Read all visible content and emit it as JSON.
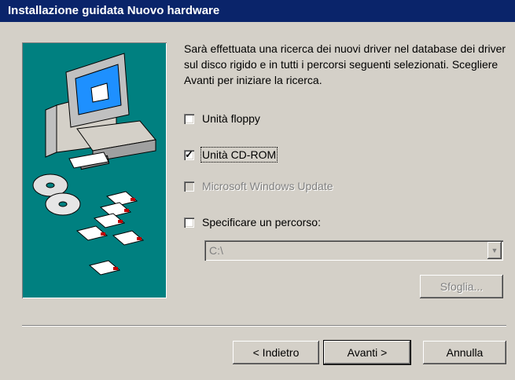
{
  "window": {
    "title": "Installazione guidata Nuovo hardware"
  },
  "intro_text": "Sarà effettuata una ricerca dei nuovi driver nel database dei driver sul disco rigido e in tutti i percorsi seguenti selezionati. Scegliere Avanti per iniziare la ricerca.",
  "options": {
    "floppy": {
      "label": "Unità floppy",
      "checked": false
    },
    "cdrom": {
      "label": "Unità CD-ROM",
      "checked": true
    },
    "windows_update": {
      "label": "Microsoft Windows Update",
      "checked": false,
      "enabled": false
    },
    "path": {
      "label": "Specificare un percorso:",
      "checked": false
    }
  },
  "path_field": {
    "value": "C:\\"
  },
  "buttons": {
    "browse": "Sfoglia...",
    "back": "< Indietro",
    "next": "Avanti >",
    "cancel": "Annulla"
  },
  "colors": {
    "titlebar": "#0a246a",
    "art_background": "#008080",
    "dialog_face": "#d4d0c8"
  },
  "icons": [
    "computer-icon",
    "cd-icon",
    "floppy-disk-icon",
    "checkbox-tick-icon",
    "dropdown-arrow-icon"
  ]
}
